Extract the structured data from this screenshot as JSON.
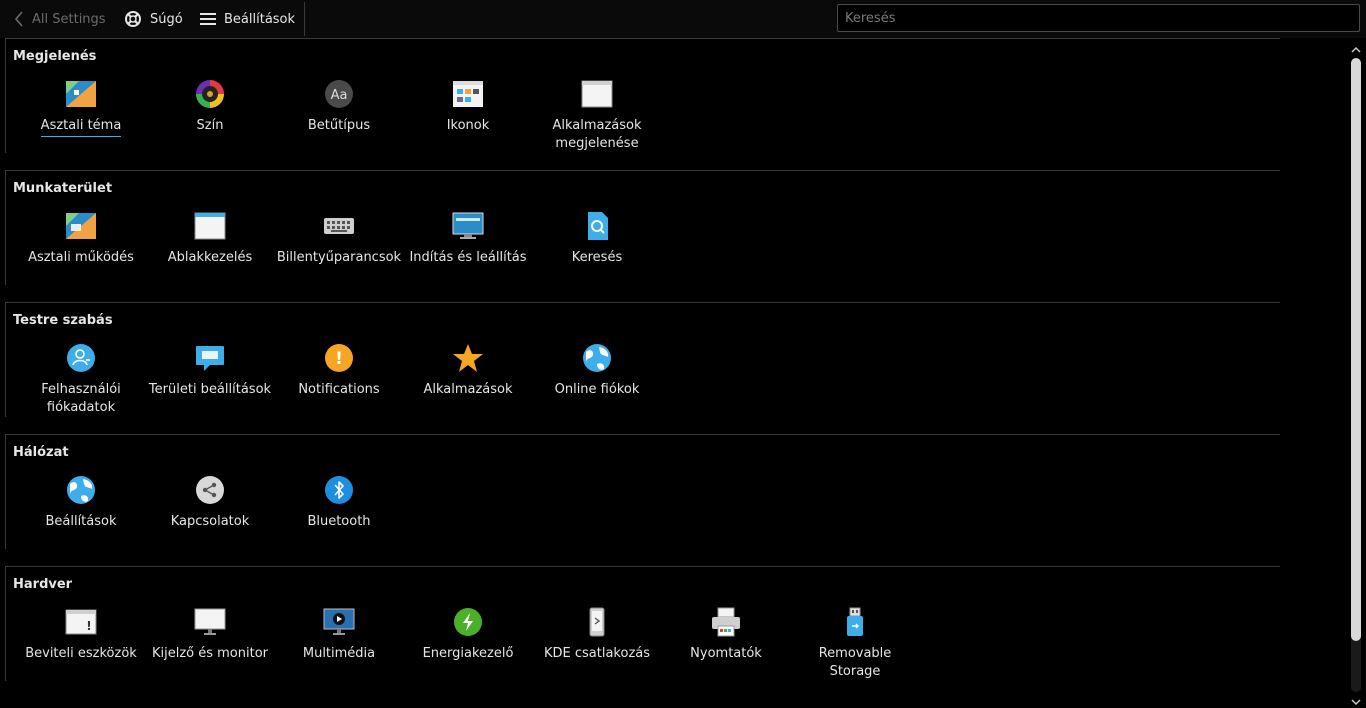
{
  "toolbar": {
    "back_label": "All Settings",
    "help_label": "Súgó",
    "menu_label": "Beállítások",
    "search_placeholder": "Keresés"
  },
  "sections": [
    {
      "title": "Megjelenés",
      "items": [
        {
          "label": "Asztali téma",
          "icon": "desktop-theme-icon",
          "active": true
        },
        {
          "label": "Szín",
          "icon": "color-wheel-icon"
        },
        {
          "label": "Betűtípus",
          "icon": "font-icon",
          "glyph": "Aa"
        },
        {
          "label": "Ikonok",
          "icon": "icons-icon"
        },
        {
          "label": "Alkalmazások\nmegjelenése",
          "icon": "app-style-icon"
        }
      ]
    },
    {
      "title": "Munkaterület",
      "items": [
        {
          "label": "Asztali működés",
          "icon": "desktop-behavior-icon"
        },
        {
          "label": "Ablakkezelés",
          "icon": "window-management-icon"
        },
        {
          "label": "Billentyűparancsok",
          "icon": "keyboard-icon"
        },
        {
          "label": "Indítás és leállítás",
          "icon": "startup-shutdown-icon"
        },
        {
          "label": "Keresés",
          "icon": "search-file-icon"
        }
      ]
    },
    {
      "title": "Testre szabás",
      "items": [
        {
          "label": "Felhasználói\nfiókadatok",
          "icon": "user-account-icon"
        },
        {
          "label": "Területi beállítások",
          "icon": "regional-settings-icon"
        },
        {
          "label": "Notifications",
          "icon": "notification-icon",
          "glyph": "!"
        },
        {
          "label": "Alkalmazások",
          "icon": "star-icon"
        },
        {
          "label": "Online fiókok",
          "icon": "globe-icon"
        }
      ]
    },
    {
      "title": "Hálózat",
      "items": [
        {
          "label": "Beállítások",
          "icon": "network-globe-icon"
        },
        {
          "label": "Kapcsolatok",
          "icon": "share-icon"
        },
        {
          "label": "Bluetooth",
          "icon": "bluetooth-icon"
        }
      ]
    },
    {
      "title": "Hardver",
      "items": [
        {
          "label": "Beviteli eszközök",
          "icon": "input-devices-icon",
          "glyph": "!"
        },
        {
          "label": "Kijelző és monitor",
          "icon": "monitor-icon"
        },
        {
          "label": "Multimédia",
          "icon": "multimedia-icon"
        },
        {
          "label": "Energiakezelő",
          "icon": "power-icon"
        },
        {
          "label": "KDE csatlakozás",
          "icon": "kde-connect-icon"
        },
        {
          "label": "Nyomtatók",
          "icon": "printer-icon"
        },
        {
          "label": "Removable\nStorage",
          "icon": "usb-storage-icon"
        }
      ]
    }
  ],
  "colors": {
    "accent": "#3daee9",
    "background": "#000000",
    "text": "#e6e6e6"
  }
}
